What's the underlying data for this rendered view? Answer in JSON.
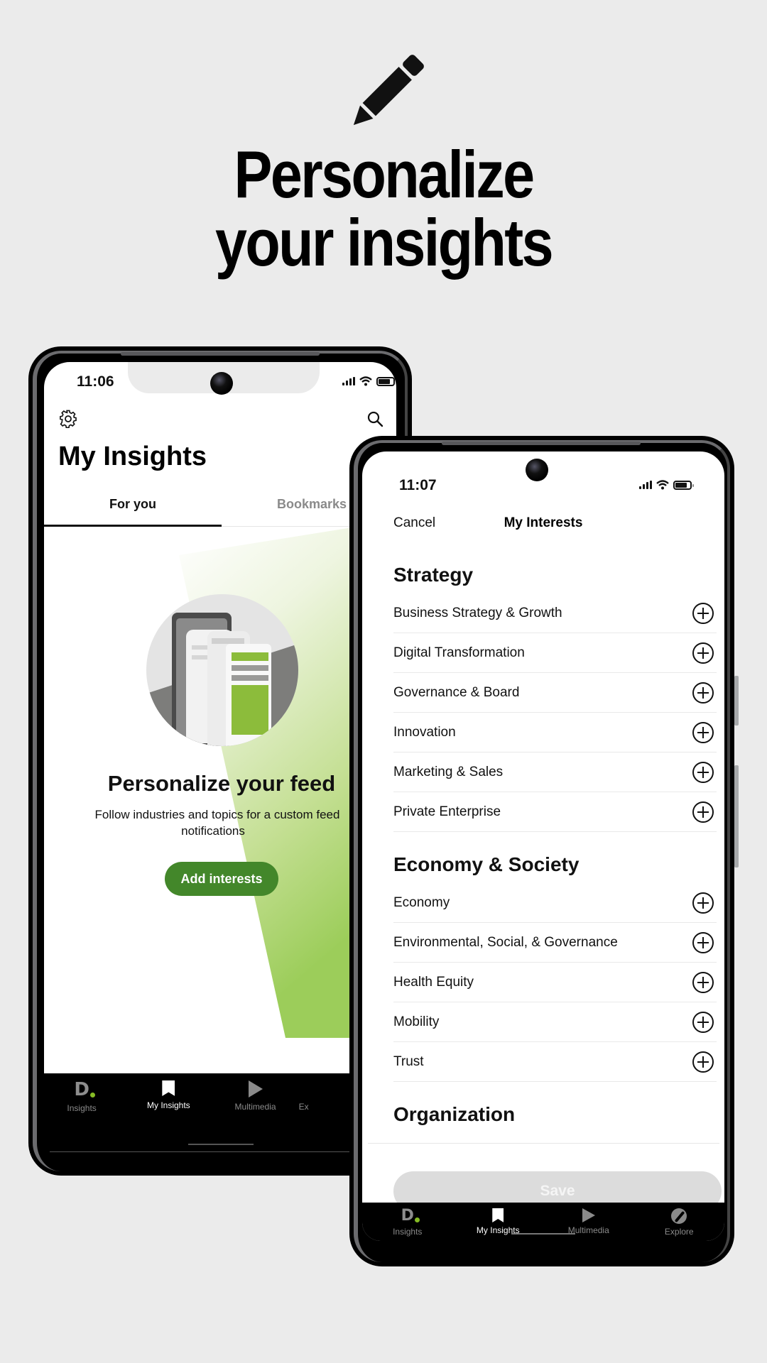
{
  "hero": {
    "icon": "pencil-icon",
    "title_line1": "Personalize",
    "title_line2": "your insights"
  },
  "phone_left": {
    "status": {
      "time": "11:06",
      "icons": [
        "signal-icon",
        "wifi-icon",
        "battery-icon"
      ]
    },
    "header": {
      "left_icon": "gear-icon",
      "right_icon": "search-icon",
      "title": "My Insights"
    },
    "tabs": [
      {
        "label": "For you",
        "active": true
      },
      {
        "label": "Bookmarks",
        "active": false
      }
    ],
    "empty_state": {
      "illustration": "phone-with-articles-illustration",
      "title": "Personalize your feed",
      "description": "Follow industries and topics for a custom feed and notifications",
      "description_visible": "Follow industries and topics for a custom feed",
      "description_line2": "notifications",
      "button_label": "Add interests"
    },
    "tabbar": [
      {
        "label": "Insights",
        "icon": "deloitte-d-logo-icon",
        "active": false
      },
      {
        "label": "My Insights",
        "icon": "bookmark-icon",
        "active": true
      },
      {
        "label": "Multimedia",
        "icon": "play-icon",
        "active": false
      },
      {
        "label": "Ex",
        "icon": "compass-icon",
        "active": false
      }
    ]
  },
  "phone_right": {
    "status": {
      "time": "11:07",
      "icons": [
        "signal-icon",
        "wifi-icon",
        "battery-icon"
      ]
    },
    "header": {
      "cancel_label": "Cancel",
      "title": "My Interests"
    },
    "sections": [
      {
        "title": "Strategy",
        "items": [
          "Business Strategy & Growth",
          "Digital Transformation",
          "Governance & Board",
          "Innovation",
          "Marketing & Sales",
          "Private Enterprise"
        ]
      },
      {
        "title": "Economy & Society",
        "items": [
          "Economy",
          "Environmental, Social, & Governance",
          "Health Equity",
          "Mobility",
          "Trust"
        ]
      },
      {
        "title": "Organization",
        "items": []
      }
    ],
    "save_label": "Save",
    "tabbar": [
      {
        "label": "Insights",
        "icon": "deloitte-d-logo-icon",
        "active": false
      },
      {
        "label": "My Insights",
        "icon": "bookmark-icon",
        "active": true
      },
      {
        "label": "Multimedia",
        "icon": "play-icon",
        "active": false
      },
      {
        "label": "Explore",
        "icon": "compass-icon",
        "active": false
      }
    ]
  },
  "colors": {
    "background": "#ebebeb",
    "brand_green": "#43872a",
    "logo_dot_green": "#86bc25",
    "save_disabled": "#dcdcdc"
  }
}
